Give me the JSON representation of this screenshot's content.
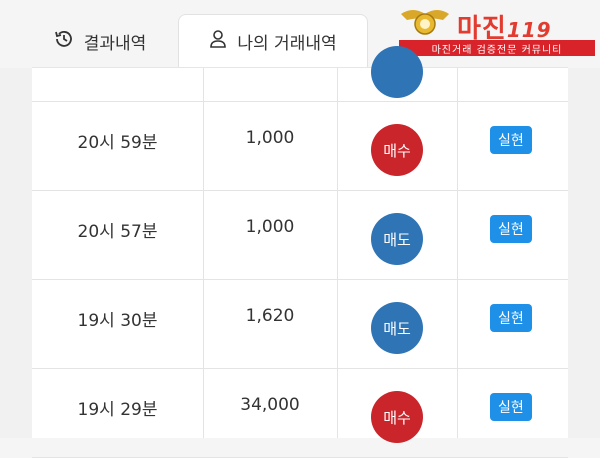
{
  "tabs": [
    {
      "label": "결과내역",
      "icon": "history-icon",
      "active": false
    },
    {
      "label": "나의 거래내역",
      "icon": "user-icon",
      "active": true
    }
  ],
  "watermark": {
    "title": "마진",
    "suffix": "119",
    "banner": "마진거래 검증전문 커뮤니티"
  },
  "colors": {
    "buy": "#c9252b",
    "sell": "#2f74b5",
    "status": "#1e90e8"
  },
  "rows": [
    {
      "time": "20시 59분",
      "amount": "1,000",
      "type": "매수",
      "type_color": "#c9252b",
      "status": "실현"
    },
    {
      "time": "20시 57분",
      "amount": "1,000",
      "type": "매도",
      "type_color": "#2f74b5",
      "status": "실현"
    },
    {
      "time": "19시 30분",
      "amount": "1,620",
      "type": "매도",
      "type_color": "#2f74b5",
      "status": "실현"
    },
    {
      "time": "19시 29분",
      "amount": "34,000",
      "type": "매수",
      "type_color": "#c9252b",
      "status": "실현"
    }
  ]
}
